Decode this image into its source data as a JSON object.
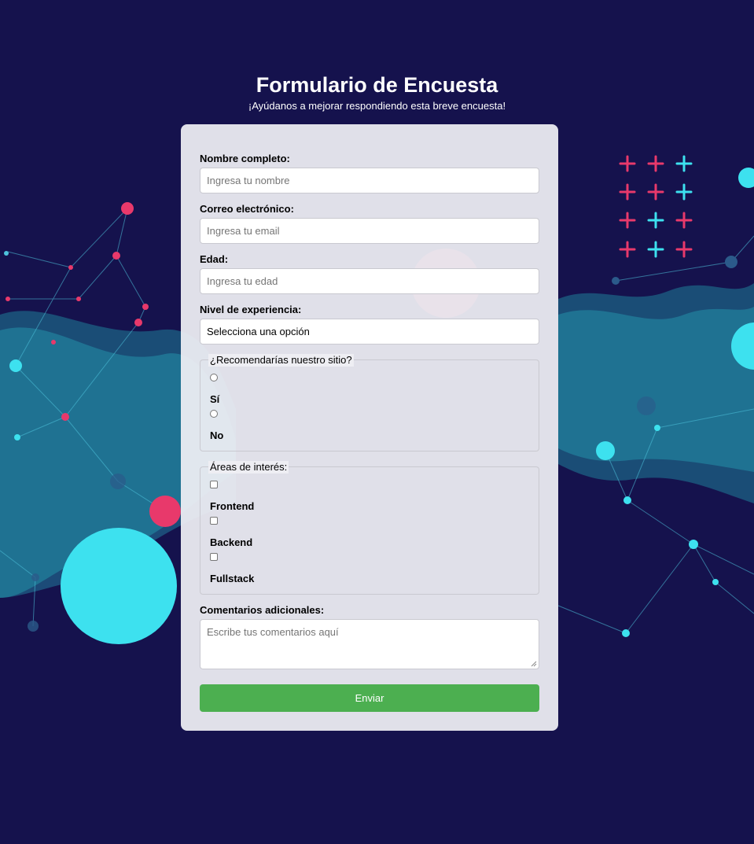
{
  "header": {
    "title": "Formulario de Encuesta",
    "subtitle": "¡Ayúdanos a mejorar respondiendo esta breve encuesta!"
  },
  "form": {
    "name": {
      "label": "Nombre completo:",
      "placeholder": "Ingresa tu nombre"
    },
    "email": {
      "label": "Correo electrónico:",
      "placeholder": "Ingresa tu email"
    },
    "age": {
      "label": "Edad:",
      "placeholder": "Ingresa tu edad"
    },
    "level": {
      "label": "Nivel de experiencia:",
      "selected": "Selecciona una opción"
    },
    "recommend": {
      "legend": "¿Recomendarías nuestro sitio?",
      "options": [
        "Sí",
        "No"
      ]
    },
    "interests": {
      "legend": "Áreas de interés:",
      "options": [
        "Frontend",
        "Backend",
        "Fullstack"
      ]
    },
    "comments": {
      "label": "Comentarios adicionales:",
      "placeholder": "Escribe tus comentarios aquí"
    },
    "submit_label": "Enviar"
  },
  "colors": {
    "background": "#15124d",
    "accent_cyan": "#3de1ef",
    "accent_pink": "#e8396b",
    "submit": "#4caf50"
  }
}
